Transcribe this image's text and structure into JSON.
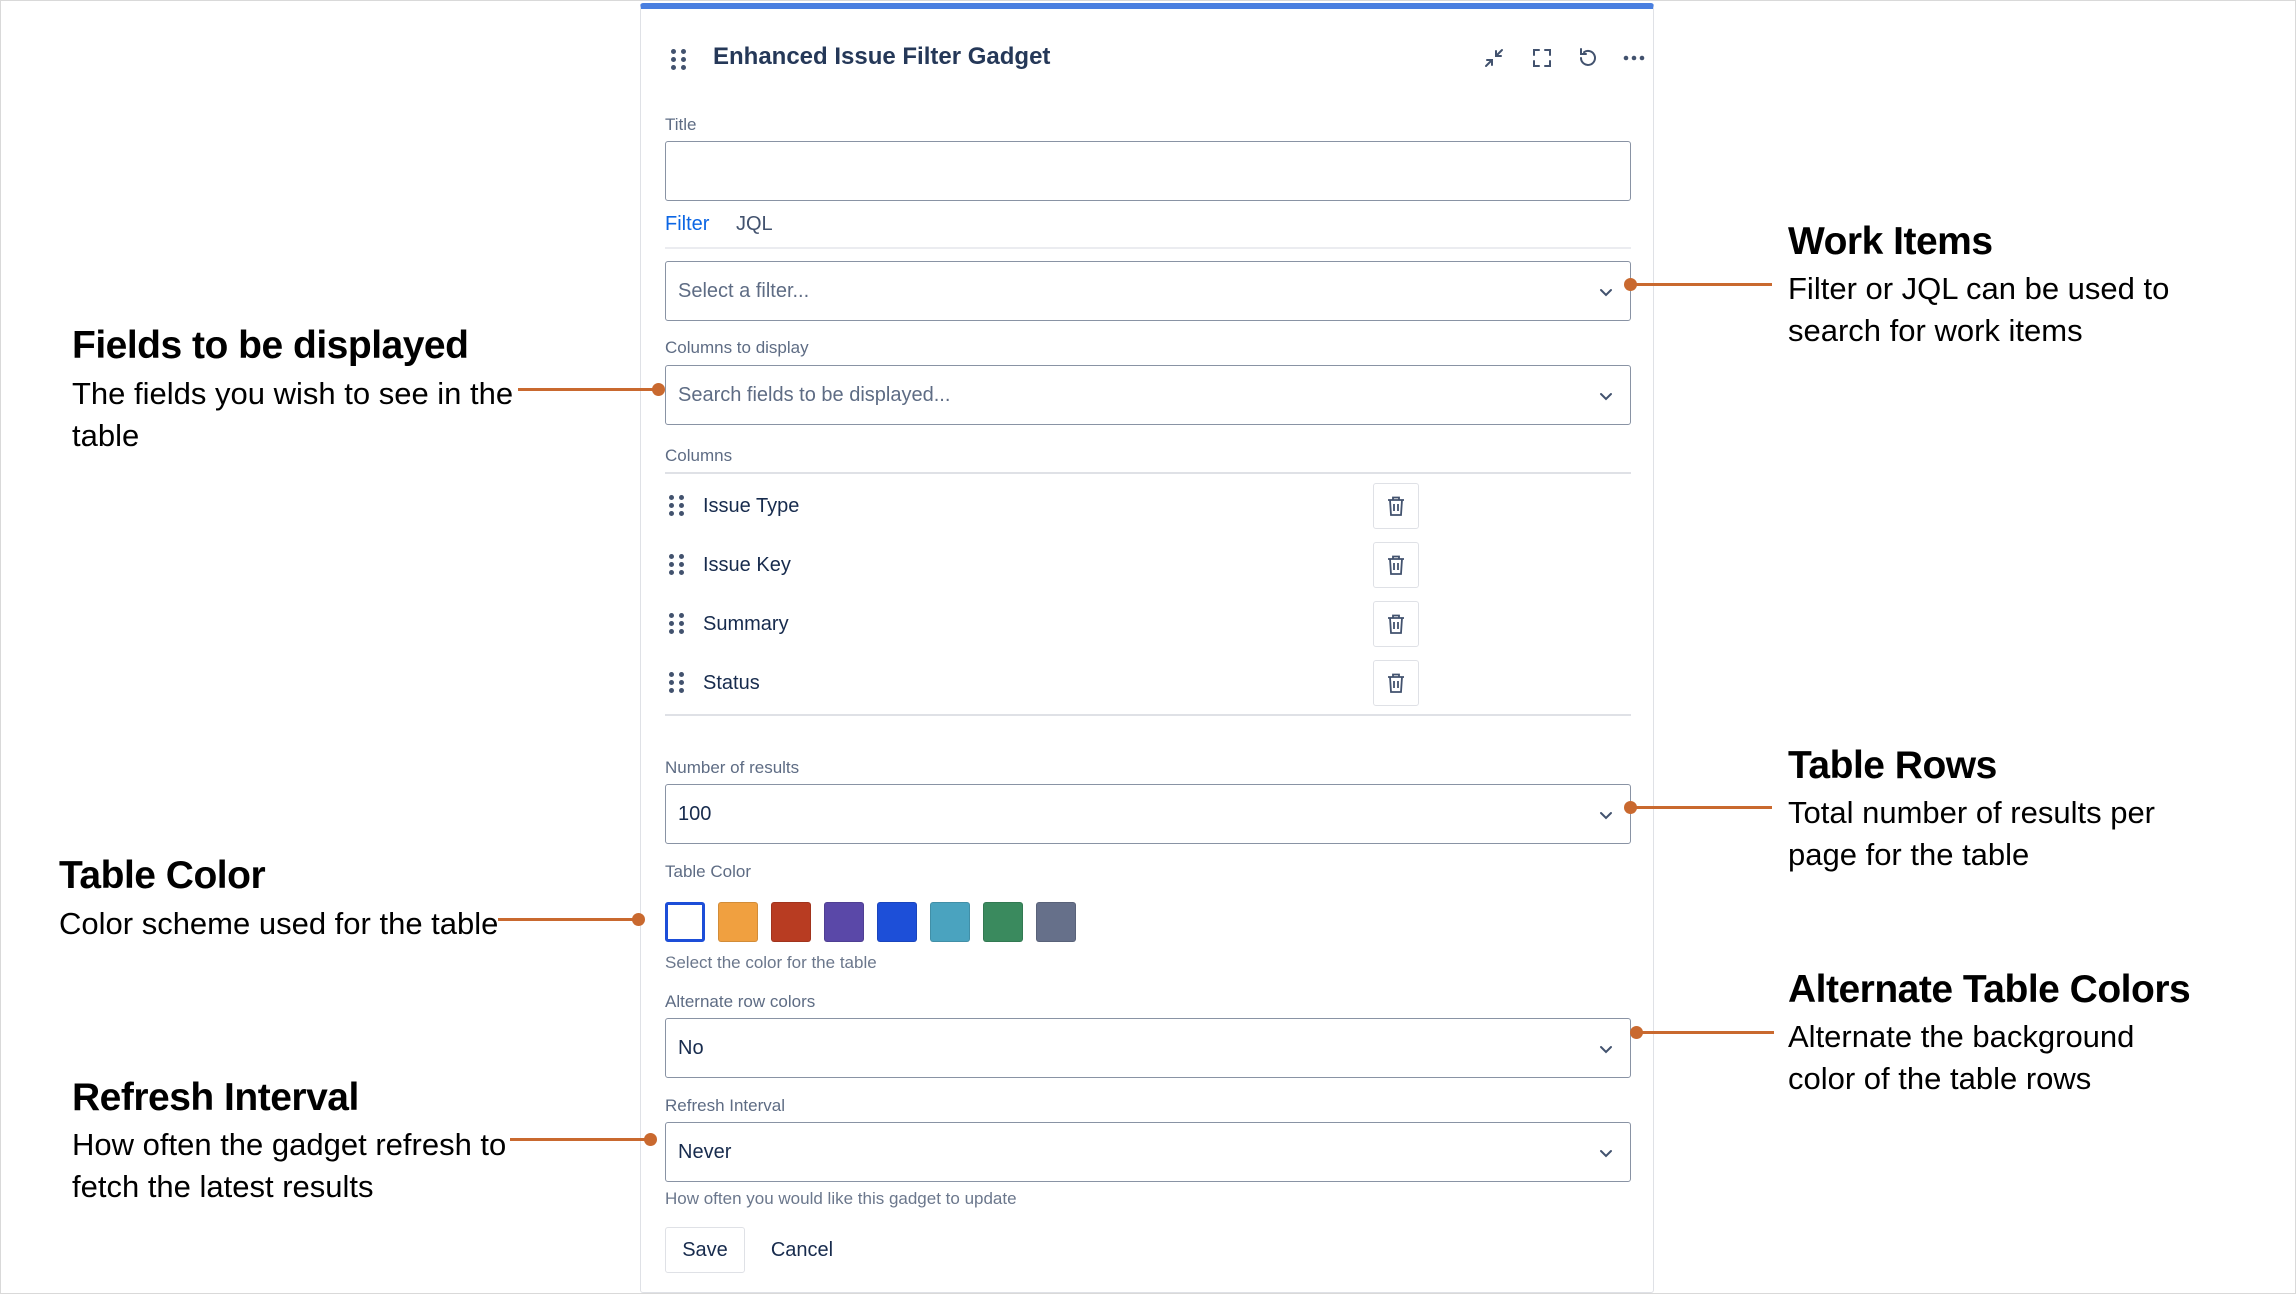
{
  "gadget": {
    "title": "Enhanced Issue Filter Gadget",
    "accent_color": "#4a7fe0",
    "header_icons": [
      "minimize-icon",
      "fullscreen-icon",
      "refresh-icon",
      "more-icon"
    ]
  },
  "form": {
    "title_label": "Title",
    "title_value": "",
    "tabs": [
      {
        "label": "Filter",
        "active": true
      },
      {
        "label": "JQL",
        "active": false
      }
    ],
    "filter_placeholder": "Select a filter...",
    "columns_to_display_label": "Columns to display",
    "columns_search_placeholder": "Search fields to be displayed...",
    "columns_label": "Columns",
    "columns": [
      {
        "label": "Issue Type"
      },
      {
        "label": "Issue Key"
      },
      {
        "label": "Summary"
      },
      {
        "label": "Status"
      }
    ],
    "number_of_results_label": "Number of results",
    "number_of_results_value": "100",
    "table_color_label": "Table Color",
    "table_colors": [
      "#ffffff",
      "#f0a040",
      "#b83c22",
      "#5a48a8",
      "#1d4fd8",
      "#4aa3bf",
      "#3a8a5e",
      "#66708a"
    ],
    "selected_color_index": 0,
    "table_color_help": "Select the color for the table",
    "alternate_rows_label": "Alternate row colors",
    "alternate_rows_value": "No",
    "refresh_label": "Refresh Interval",
    "refresh_value": "Never",
    "refresh_help": "How often you would like this gadget to update",
    "save_label": "Save",
    "cancel_label": "Cancel"
  },
  "annotations": {
    "accent_color": "#c9692f",
    "work_items": {
      "title": "Work Items",
      "desc": "Filter or JQL can be used to search for work items"
    },
    "fields": {
      "title": "Fields to be displayed",
      "desc": "The fields you wish to see in the table"
    },
    "table_rows": {
      "title": "Table Rows",
      "desc": "Total number of results per page for the table"
    },
    "table_color": {
      "title": "Table Color",
      "desc": "Color scheme used for the table"
    },
    "alternate_colors": {
      "title": "Alternate Table Colors",
      "desc": "Alternate the background color of the table rows"
    },
    "refresh": {
      "title": "Refresh Interval",
      "desc": "How often the gadget refresh to fetch the latest results"
    }
  }
}
